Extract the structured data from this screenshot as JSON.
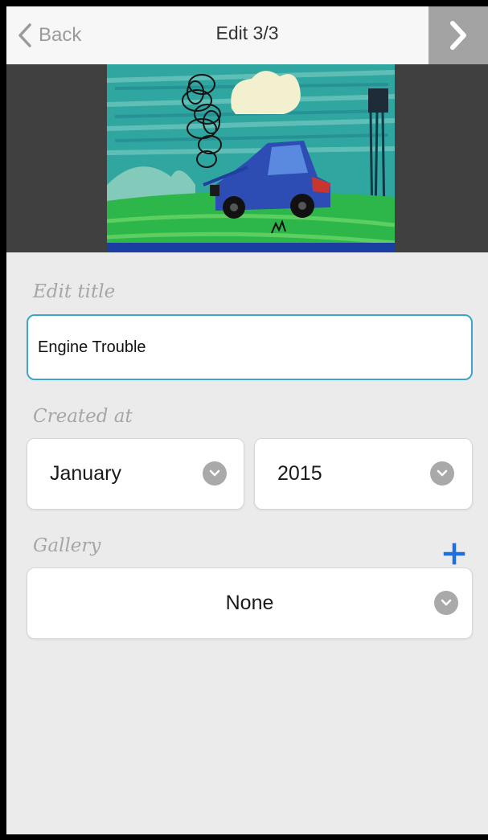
{
  "navbar": {
    "back_label": "Back",
    "title": "Edit 3/3",
    "back_icon": "chevron-left-icon",
    "next_icon": "chevron-right-icon"
  },
  "image": {
    "alt": "Child's drawing of a blue car with smoke"
  },
  "form": {
    "title_label": "Edit title",
    "title_value": "Engine Trouble",
    "created_label": "Created at",
    "month_value": "January",
    "year_value": "2015",
    "gallery_label": "Gallery",
    "gallery_value": "None",
    "add_icon": "plus-icon",
    "dropdown_icon": "chevron-down-icon"
  },
  "colors": {
    "accent_blue": "#1d6fe0",
    "input_focus_border": "#3aa7c9",
    "background": "#ebebeb"
  }
}
